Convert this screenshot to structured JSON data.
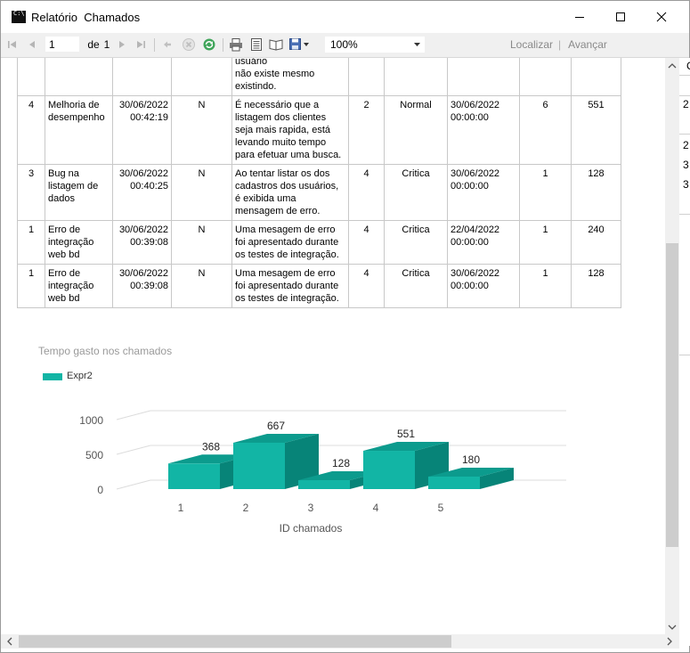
{
  "window": {
    "title": "Relatório  Chamados",
    "app_icon_text": "C:\\",
    "minimize_icon": "minimize-icon",
    "maximize_icon": "maximize-icon",
    "close_icon": "close-icon"
  },
  "toolbar": {
    "page_value": "1",
    "of_label": "de",
    "total_pages": "1",
    "zoom_value": "100%",
    "find_label": "Localizar",
    "separator": "|",
    "next_label": "Avançar"
  },
  "report": {
    "top_partial": [
      "informando que o usuário",
      "não existe mesmo",
      "existindo."
    ],
    "rows": [
      {
        "prioridade": "4",
        "titulo": "Melhoria de desempenho",
        "data": "30/06/2022",
        "hora": "00:42:19",
        "flag": "N",
        "descricao": "É necessário que a listagem dos clientes seja mais rapida, está levando muito tempo para efetuar uma busca.",
        "nivel": "2",
        "severidade": "Normal",
        "prazo": "30/06/2022",
        "prazo_hora": "00:00:00",
        "qtd": "6",
        "tempo": "551"
      },
      {
        "prioridade": "3",
        "titulo": "Bug na listagem de dados",
        "data": "30/06/2022",
        "hora": "00:40:25",
        "flag": "N",
        "descricao": "Ao tentar listar os dos cadastros dos usuários, é exibida uma mensagem de erro.",
        "nivel": "4",
        "severidade": "Critica",
        "prazo": "30/06/2022",
        "prazo_hora": "00:00:00",
        "qtd": "1",
        "tempo": "128"
      },
      {
        "prioridade": "1",
        "titulo": "Erro de integração web bd",
        "data": "30/06/2022",
        "hora": "00:39:08",
        "flag": "N",
        "descricao": "Uma mesagem de erro foi apresentado durante os testes de integração.",
        "nivel": "4",
        "severidade": "Critica",
        "prazo": "22/04/2022",
        "prazo_hora": "00:00:00",
        "qtd": "1",
        "tempo": "240"
      },
      {
        "prioridade": "1",
        "titulo": "Erro de integração web bd",
        "data": "30/06/2022",
        "hora": "00:39:08",
        "flag": "N",
        "descricao": "Uma mesagem de erro foi apresentado durante os testes de integração.",
        "nivel": "4",
        "severidade": "Critica",
        "prazo": "30/06/2022",
        "prazo_hora": "00:00:00",
        "qtd": "1",
        "tempo": "128"
      }
    ]
  },
  "behind_window": {
    "texts": [
      "C",
      "2",
      "2",
      "3",
      "3"
    ]
  },
  "chart_data": {
    "type": "bar",
    "title": "Tempo gasto nos chamados",
    "xlabel": "ID chamados",
    "ylabel": "",
    "categories": [
      "1",
      "2",
      "3",
      "4",
      "5"
    ],
    "series": [
      {
        "name": "Expr2",
        "values": [
          368,
          667,
          128,
          551,
          180
        ]
      }
    ],
    "yticks": [
      "1000",
      "500",
      "0"
    ],
    "ylim": [
      0,
      1000
    ],
    "three_d": true,
    "data_labels": true,
    "legend_position": "top-left",
    "grid": true,
    "color": "#12b5a5"
  }
}
